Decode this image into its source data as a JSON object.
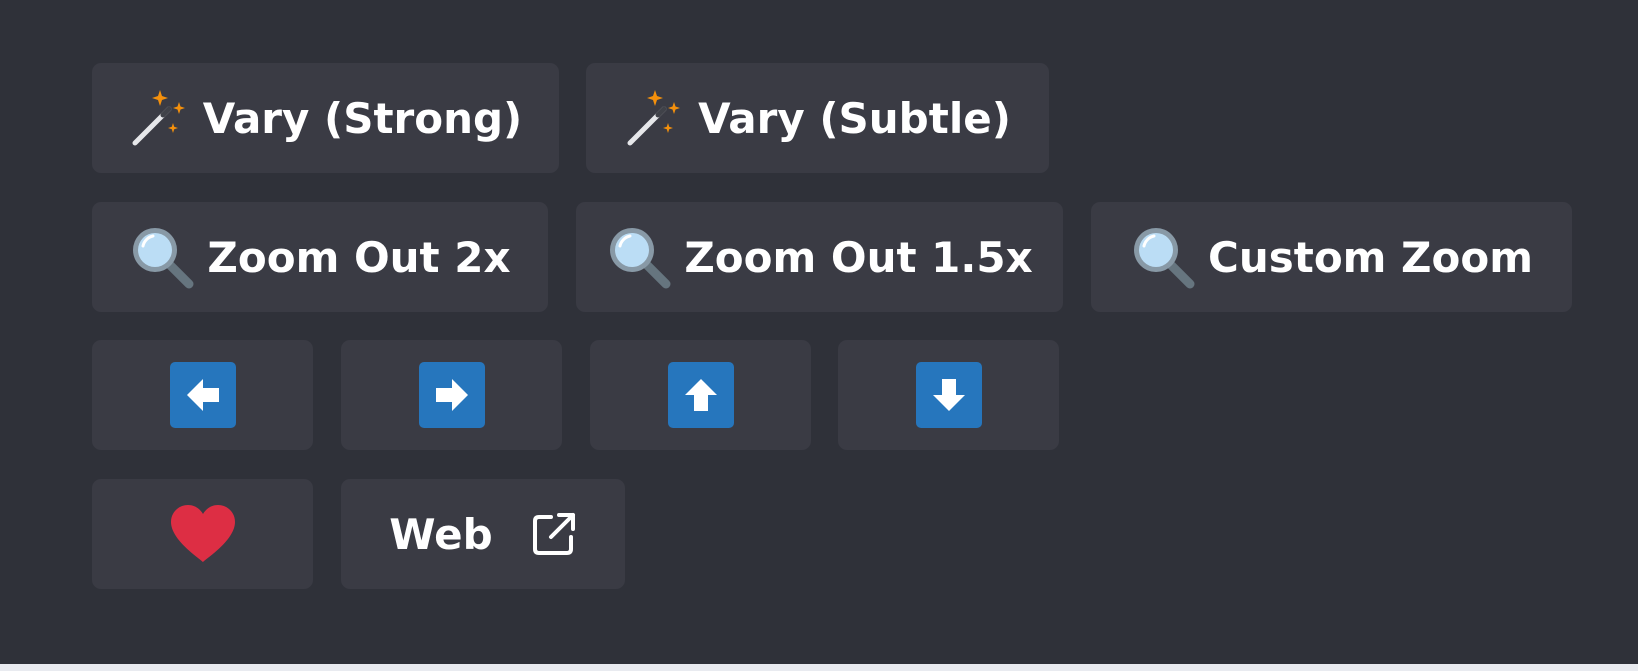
{
  "buttons": {
    "vary_strong": {
      "label": "Vary (Strong)",
      "icon": "magic-wand-icon"
    },
    "vary_subtle": {
      "label": "Vary (Subtle)",
      "icon": "magic-wand-icon"
    },
    "zoom_out_2x": {
      "label": "Zoom Out 2x",
      "icon": "magnifier-icon"
    },
    "zoom_out_15x": {
      "label": "Zoom Out 1.5x",
      "icon": "magnifier-icon"
    },
    "custom_zoom": {
      "label": "Custom Zoom",
      "icon": "magnifier-icon"
    },
    "pan_left": {
      "icon": "arrow-left-icon"
    },
    "pan_right": {
      "icon": "arrow-right-icon"
    },
    "pan_up": {
      "icon": "arrow-up-icon"
    },
    "pan_down": {
      "icon": "arrow-down-icon"
    },
    "favorite": {
      "icon": "heart-icon"
    },
    "web": {
      "label": "Web",
      "icon": "external-link-icon"
    }
  },
  "colors": {
    "background": "#2f3139",
    "button": "#3a3b44",
    "arrow": "#2676bd",
    "heart": "#dd2e44",
    "text": "#ffffff"
  }
}
